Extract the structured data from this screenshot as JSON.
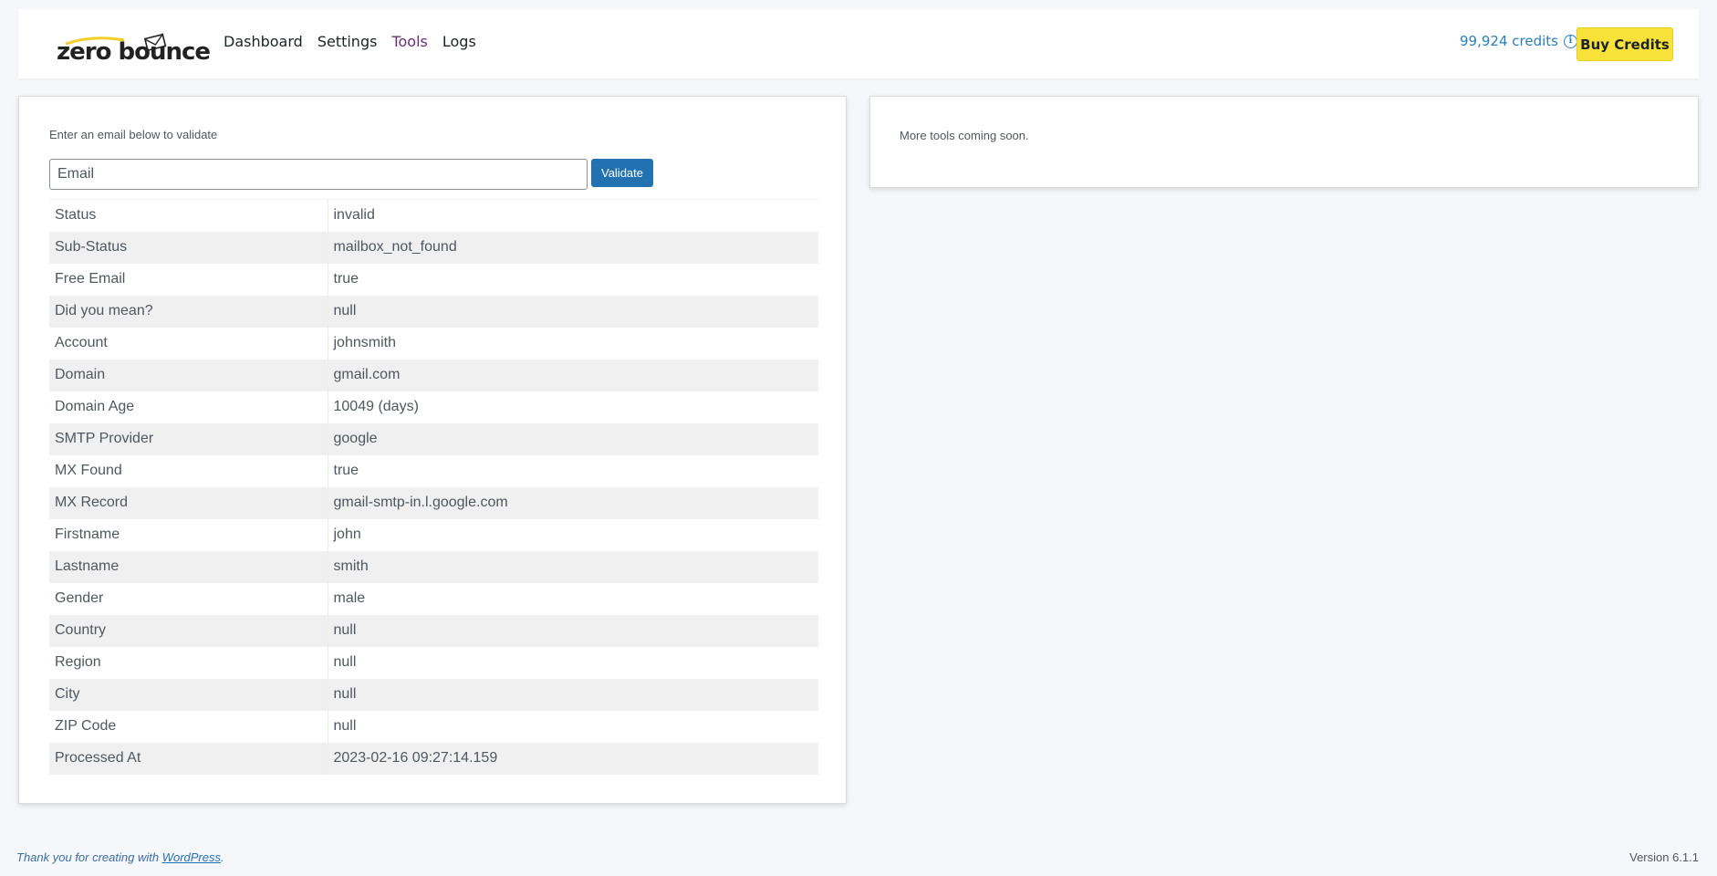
{
  "header": {
    "logo_text": "zero bounce",
    "nav": [
      {
        "label": "Dashboard",
        "active": false
      },
      {
        "label": "Settings",
        "active": false
      },
      {
        "label": "Tools",
        "active": true
      },
      {
        "label": "Logs",
        "active": false
      }
    ],
    "credits": "99,924 credits",
    "buy_label": "Buy Credits"
  },
  "validator": {
    "prompt": "Enter an email below to validate",
    "email_placeholder": "Email",
    "email_value": "",
    "validate_label": "Validate",
    "results": [
      {
        "label": "Status",
        "value": "invalid"
      },
      {
        "label": "Sub-Status",
        "value": "mailbox_not_found"
      },
      {
        "label": "Free Email",
        "value": "true"
      },
      {
        "label": "Did you mean?",
        "value": "null"
      },
      {
        "label": "Account",
        "value": "johnsmith"
      },
      {
        "label": "Domain",
        "value": "gmail.com"
      },
      {
        "label": "Domain Age",
        "value": "10049 (days)"
      },
      {
        "label": "SMTP Provider",
        "value": "google"
      },
      {
        "label": "MX Found",
        "value": "true"
      },
      {
        "label": "MX Record",
        "value": "gmail-smtp-in.l.google.com"
      },
      {
        "label": "Firstname",
        "value": "john"
      },
      {
        "label": "Lastname",
        "value": "smith"
      },
      {
        "label": "Gender",
        "value": "male"
      },
      {
        "label": "Country",
        "value": "null"
      },
      {
        "label": "Region",
        "value": "null"
      },
      {
        "label": "City",
        "value": "null"
      },
      {
        "label": "ZIP Code",
        "value": "null"
      },
      {
        "label": "Processed At",
        "value": "2023-02-16 09:27:14.159"
      }
    ]
  },
  "right_panel": {
    "text": "More tools coming soon."
  },
  "footer": {
    "thanks_prefix": "Thank you for creating with ",
    "wordpress_link": "WordPress",
    "thanks_suffix": ".",
    "version": "Version 6.1.1"
  },
  "colors": {
    "accent": "#2271b1",
    "buy_button": "#f8e23a",
    "active_nav": "#6b2c79",
    "credits": "#2c7fb8"
  }
}
